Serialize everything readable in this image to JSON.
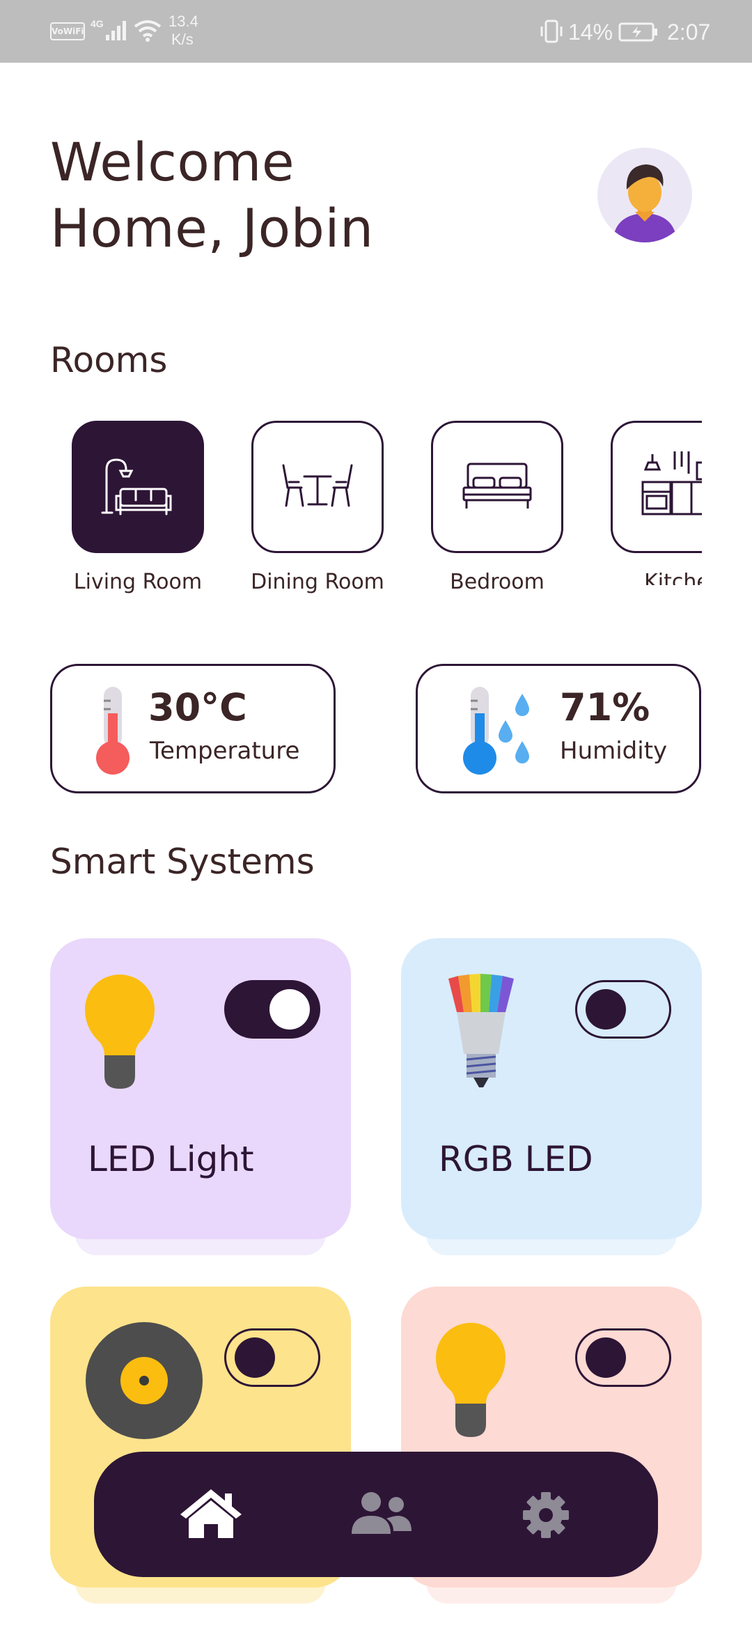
{
  "status_bar": {
    "wifi_label": "VoWiFi",
    "network": "4G",
    "speed_value": "13.4",
    "speed_unit": "K/s",
    "battery": "14%",
    "time": "2:07"
  },
  "header": {
    "title_line1": "Welcome",
    "title_line2": "Home, Jobin"
  },
  "rooms": {
    "title": "Rooms",
    "items": [
      {
        "label": "Living Room",
        "icon": "living-room-icon",
        "active": true
      },
      {
        "label": "Dining Room",
        "icon": "dining-room-icon",
        "active": false
      },
      {
        "label": "Bedroom",
        "icon": "bedroom-icon",
        "active": false
      },
      {
        "label": "Kitche",
        "icon": "kitchen-icon",
        "active": false
      }
    ]
  },
  "sensors": [
    {
      "value": "30°C",
      "label": "Temperature",
      "icon": "thermometer-hot-icon"
    },
    {
      "value": "71%",
      "label": "Humidity",
      "icon": "humidity-icon"
    }
  ],
  "smart_systems": {
    "title": "Smart Systems",
    "devices": [
      {
        "name": "LED Light",
        "icon": "bulb-icon",
        "on": true,
        "color": "#e9d8fb"
      },
      {
        "name": "RGB LED",
        "icon": "rgb-bulb-icon",
        "on": false,
        "color": "#d8ecfc"
      },
      {
        "name": "",
        "icon": "speaker-icon",
        "on": false,
        "color": "#fde38c"
      },
      {
        "name": "",
        "icon": "bulb-icon",
        "on": false,
        "color": "#fddad3"
      }
    ]
  },
  "nav": {
    "items": [
      "home-icon",
      "users-icon",
      "settings-icon"
    ]
  },
  "colors": {
    "primary": "#2d1536",
    "text": "#3b2526"
  }
}
